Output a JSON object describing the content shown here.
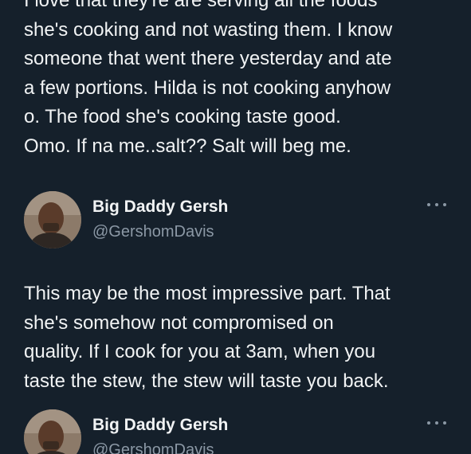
{
  "first_tweet": {
    "lines": [
      "I love that they're are serving all the foods",
      "she's cooking and not wasting them. I know",
      "someone that went there yesterday and ate",
      "a few portions. Hilda is not cooking anyhow",
      "o. The food she's cooking taste good.",
      "Omo. If na me..salt?? Salt will beg me."
    ]
  },
  "reply_1": {
    "author_name": "Big Daddy Gersh",
    "author_handle": "@GershomDavis",
    "lines": [
      "This may be the most impressive part. That",
      "she's somehow not compromised on",
      "quality. If I cook for you at 3am, when you",
      "taste the stew, the stew will taste you back."
    ]
  },
  "reply_2": {
    "author_name": "Big Daddy Gersh",
    "author_handle": "@GershomDavis"
  },
  "colors": {
    "background": "#15202b",
    "text": "#f1f3f4",
    "secondary_text": "#8b98a5"
  },
  "icons": {
    "more": "more-horizontal-icon"
  }
}
